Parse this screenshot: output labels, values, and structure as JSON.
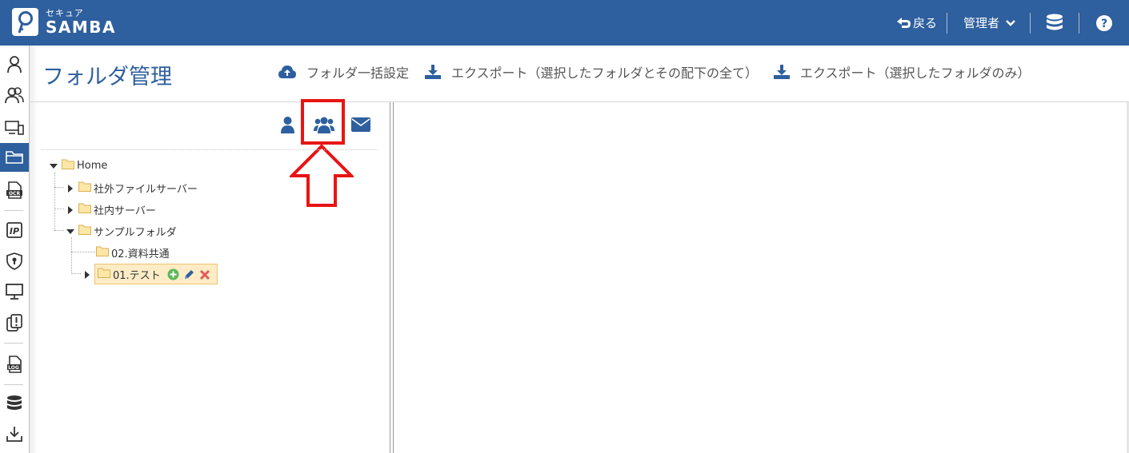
{
  "app": {
    "logo_top": "セキュア",
    "logo_main": "SAMBA"
  },
  "topbar": {
    "back_label": "戻る",
    "admin_label": "管理者"
  },
  "sidebar": {
    "items": [
      {
        "icon": "user-icon"
      },
      {
        "icon": "users-icon"
      },
      {
        "icon": "devices-icon"
      },
      {
        "icon": "folder-icon",
        "active": true
      },
      {
        "icon": "ocr-icon"
      },
      {
        "icon": "ip-icon"
      },
      {
        "icon": "shield-lock-icon"
      },
      {
        "icon": "monitor-icon"
      },
      {
        "icon": "alert-copy-icon"
      },
      {
        "icon": "log-icon"
      },
      {
        "icon": "database-icon"
      },
      {
        "icon": "download-icon"
      }
    ]
  },
  "page": {
    "title": "フォルダ管理",
    "actions": {
      "bulk_settings": "フォルダ一括設定",
      "export_all": "エクスポート（選択したフォルダとその配下の全て）",
      "export_only": "エクスポート（選択したフォルダのみ）"
    }
  },
  "tree": {
    "home": "Home",
    "external": "社外ファイルサーバー",
    "internal": "社内サーバー",
    "sample": "サンプルフォルダ",
    "child1": "02.資料共通",
    "child2": "01.テスト"
  },
  "colors": {
    "brand": "#2e5f9e",
    "highlight": "#e81414",
    "selected_bg": "#fdecc5"
  }
}
